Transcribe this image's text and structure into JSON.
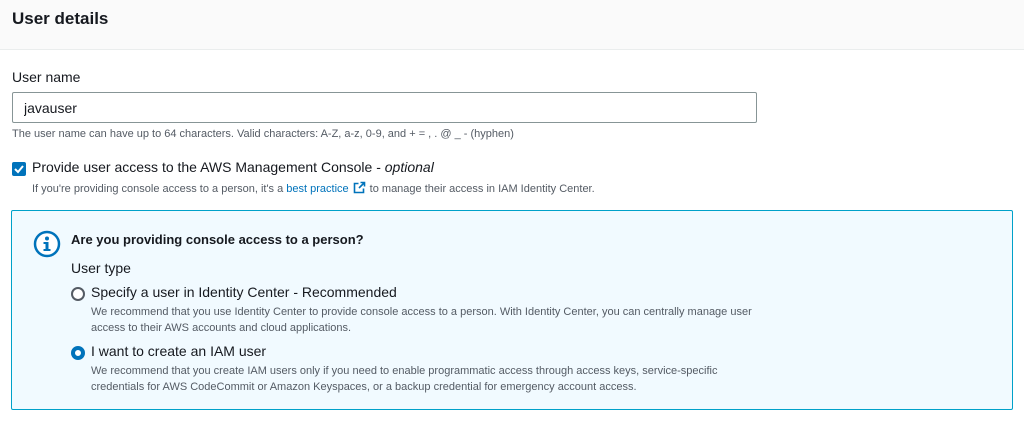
{
  "header": {
    "title": "User details"
  },
  "user_name": {
    "label": "User name",
    "value": "javauser",
    "hint": "The user name can have up to 64 characters. Valid characters: A-Z, a-z, 0-9, and + = , . @ _ - (hyphen)"
  },
  "console_access": {
    "checked": true,
    "label": "Provide user access to the AWS Management Console - ",
    "label_optional": "optional",
    "desc_before": "If you're providing console access to a person, it's a ",
    "desc_link": "best practice",
    "desc_after": " to manage their access in IAM Identity Center."
  },
  "info_panel": {
    "title": "Are you providing console access to a person?",
    "user_type_label": "User type",
    "options": [
      {
        "label": "Specify a user in Identity Center - Recommended",
        "desc": "We recommend that you use Identity Center to provide console access to a person. With Identity Center, you can centrally manage user access to their AWS accounts and cloud applications.",
        "selected": false
      },
      {
        "label": "I want to create an IAM user",
        "desc": "We recommend that you create IAM users only if you need to enable programmatic access through access keys, service-specific credentials for AWS CodeCommit or Amazon Keyspaces, or a backup credential for emergency account access.",
        "selected": true
      }
    ]
  },
  "colors": {
    "accent": "#0073bb",
    "info_bg": "#f1faff",
    "info_border": "#00a1c9"
  }
}
